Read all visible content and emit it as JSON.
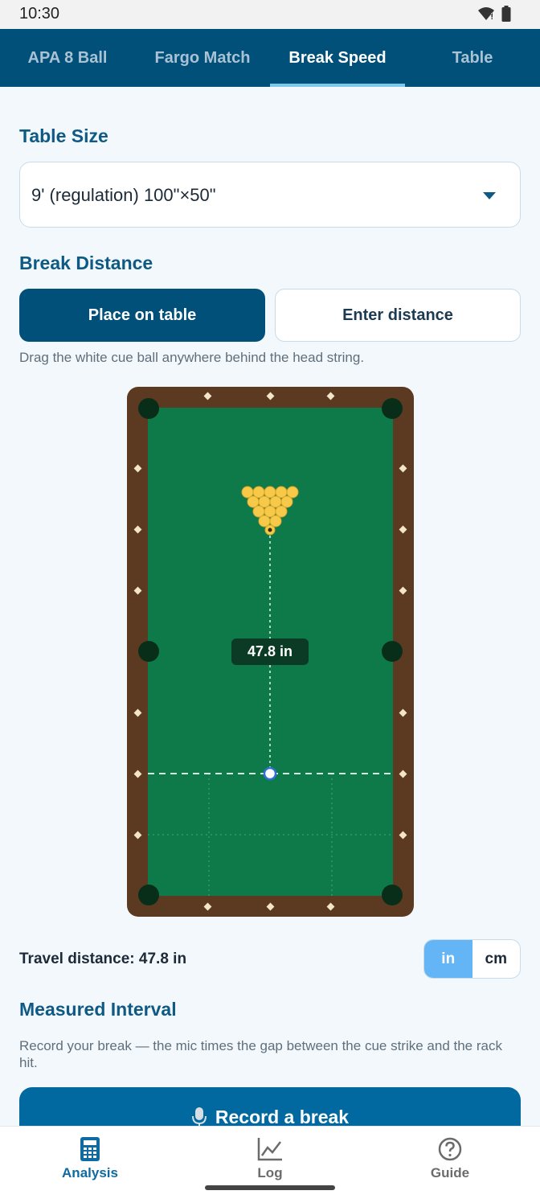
{
  "status": {
    "time": "10:30"
  },
  "tabs": [
    {
      "label": "APA 8 Ball",
      "active": false
    },
    {
      "label": "Fargo Match",
      "active": false
    },
    {
      "label": "Break Speed",
      "active": true
    },
    {
      "label": "Table",
      "active": false
    }
  ],
  "table_size": {
    "title": "Table Size",
    "selected": "9' (regulation) 100\"×50\""
  },
  "break_distance": {
    "title": "Break Distance",
    "place_label": "Place on table",
    "enter_label": "Enter distance",
    "hint": "Drag the white cue ball anywhere behind the head string.",
    "distance_label": "47.8 in"
  },
  "travel": {
    "text": "Travel distance: 47.8 in",
    "units": [
      "in",
      "cm"
    ],
    "active_unit": "in"
  },
  "interval": {
    "title": "Measured Interval",
    "description": "Record your break — the mic times the gap between the cue strike and the rack hit.",
    "record_label": "Record a break"
  },
  "nav": [
    {
      "label": "Analysis",
      "icon": "calculator-icon",
      "active": true
    },
    {
      "label": "Log",
      "icon": "line-chart-icon",
      "active": false
    },
    {
      "label": "Guide",
      "icon": "help-circle-icon",
      "active": false
    }
  ],
  "colors": {
    "brand": "#01507a",
    "accent": "#64b5f6",
    "felt": "#0e7a4a",
    "rail": "#5b3a21",
    "ball": "#f7c948"
  }
}
